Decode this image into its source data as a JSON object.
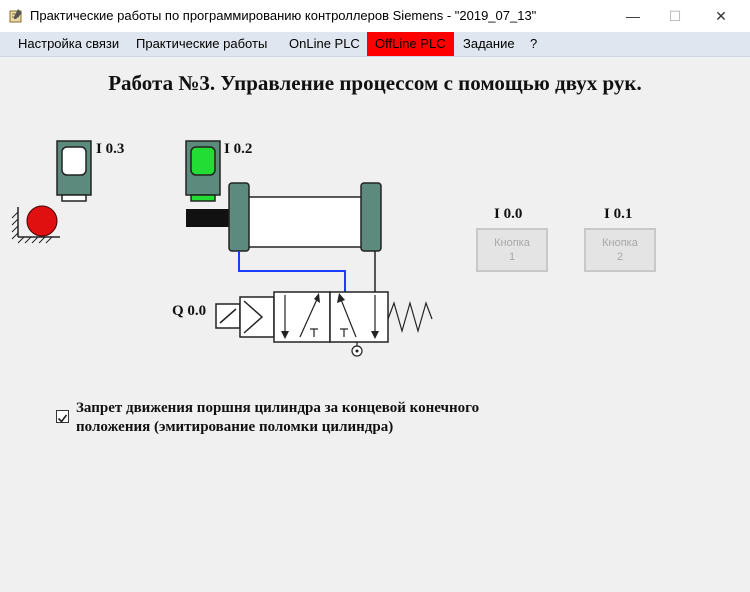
{
  "window": {
    "title": "Практические работы по программированию контроллеров Siemens - \"2019_07_13\"",
    "minimize": "—",
    "maximize": "☐",
    "close": "✕"
  },
  "menu": {
    "items": [
      {
        "label": "Настройка связи"
      },
      {
        "label": "Практические работы"
      },
      {
        "label": "OnLine PLC"
      },
      {
        "label": "OffLine PLC"
      },
      {
        "label": "Задание"
      },
      {
        "label": "?"
      }
    ],
    "offline_color": "#ff0000"
  },
  "page": {
    "title": "Работа №3. Управление процессом с помощью двух рук."
  },
  "sensors": {
    "i03": {
      "label": "I 0.3",
      "lamp_color": "#ffffff"
    },
    "i02": {
      "label": "I 0.2",
      "lamp_color": "#22dd33"
    }
  },
  "valve": {
    "label": "Q 0.0"
  },
  "buttons": {
    "b1": {
      "address": "I 0.0",
      "line1": "Кнопка",
      "line2": "1"
    },
    "b2": {
      "address": "I 0.1",
      "line1": "Кнопка",
      "line2": "2"
    }
  },
  "option": {
    "label": "Запрет движения поршня цилиндра за концевой конечного положения (эмитирование поломки цилиндра)",
    "checked": true
  }
}
